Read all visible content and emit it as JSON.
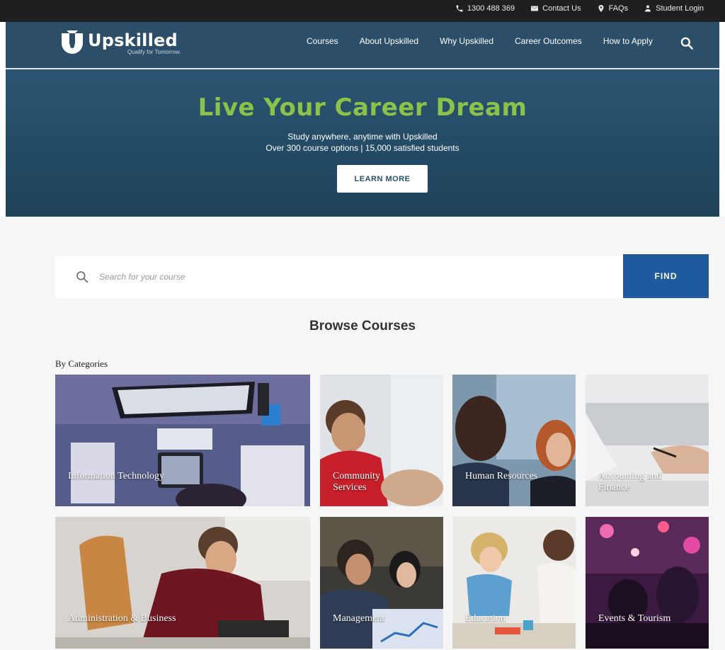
{
  "topbar": {
    "phone": "1300 488 369",
    "contact": "Contact Us",
    "faqs": "FAQs",
    "login": "Student Login"
  },
  "header": {
    "logo_text": "Upskilled",
    "logo_tagline": "Qualify for Tomorrow.",
    "nav": [
      "Courses",
      "About Upskilled",
      "Why Upskilled",
      "Career Outcomes",
      "How to Apply"
    ]
  },
  "hero": {
    "title": "Live Your Career Dream",
    "subtitle_1": "Study anywhere, anytime with Upskilled",
    "subtitle_2": "Over 300 course options | 15,000 satisfied students",
    "cta": "LEARN MORE"
  },
  "search": {
    "placeholder": "Search for your course",
    "button": "FIND"
  },
  "browse": {
    "title": "Browse Courses",
    "by_categories": "By Categories",
    "categories": [
      "Information Technology",
      "Community\nServices",
      "Human Resources",
      "Accounting and\nFinance",
      "Administration & Business",
      "Management",
      "Education",
      "Events & Tourism"
    ]
  },
  "colors": {
    "topbar": "#1f1f1f",
    "header": "#2c4e68",
    "hero_title": "#8bc34a",
    "find_button": "#1f5a9e"
  }
}
